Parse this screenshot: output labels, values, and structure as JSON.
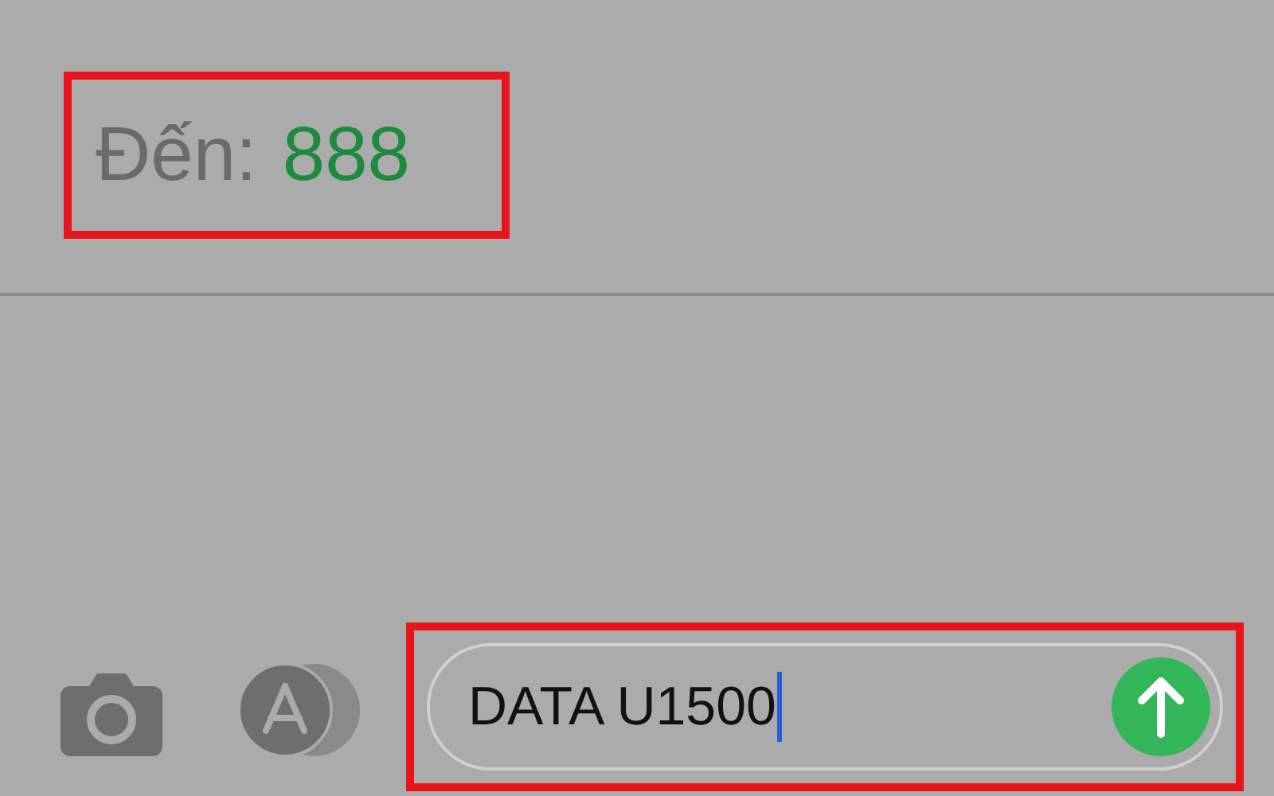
{
  "recipient": {
    "label": "Đến:",
    "value": "888",
    "highlighted": true
  },
  "composer": {
    "value": "DATA U1500",
    "focused": true,
    "highlighted": true
  }
}
